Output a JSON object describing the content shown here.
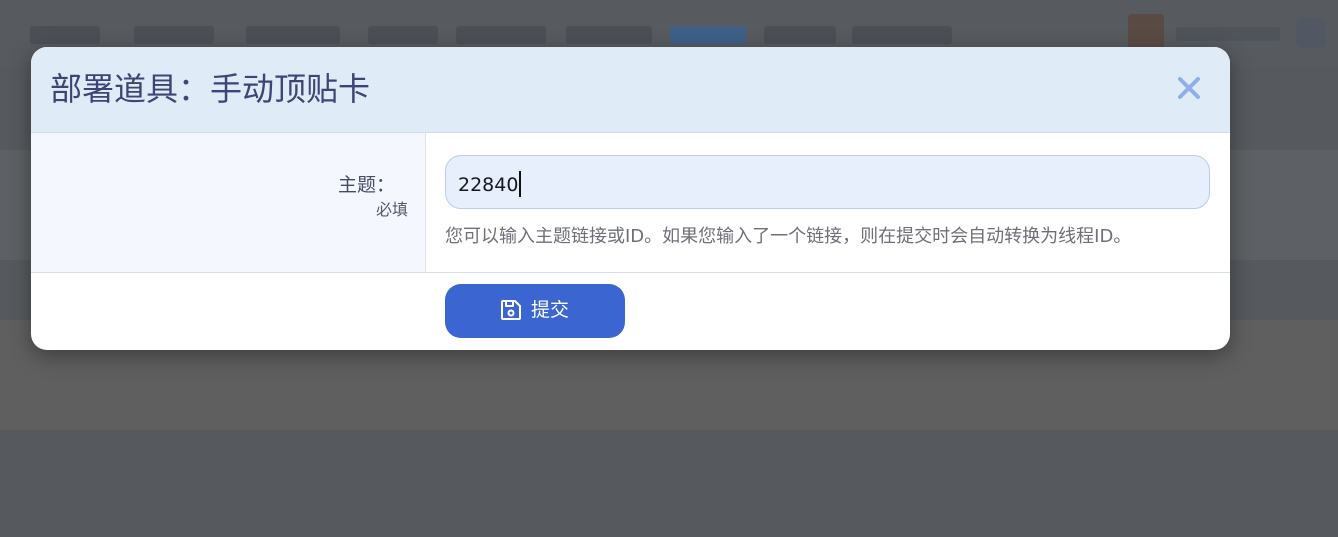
{
  "dialog": {
    "title": "部署道具：手动顶贴卡",
    "close_icon": "close-icon"
  },
  "form": {
    "topic_label": "主题：",
    "topic_required": "必填",
    "topic_value": "22840",
    "topic_hint": "您可以输入主题链接或ID。如果您输入了一个链接，则在提交时会自动转换为线程ID。"
  },
  "actions": {
    "submit_label": "提交",
    "submit_icon": "save-icon"
  },
  "colors": {
    "header_bg": "#e0ebf8",
    "title": "#3d4575",
    "close": "#8fb0e6",
    "input_bg": "#e7effd",
    "button": "#3b66d1"
  }
}
